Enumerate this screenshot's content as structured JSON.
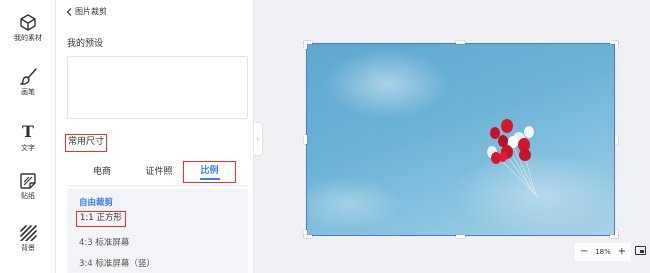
{
  "rail": [
    {
      "label": "我的素材",
      "icon": "cube-icon"
    },
    {
      "label": "画笔",
      "icon": "brush-icon"
    },
    {
      "label": "文字",
      "icon": "text-icon",
      "glyph": "T"
    },
    {
      "label": "贴纸",
      "icon": "sticker-icon"
    },
    {
      "label": "背景",
      "icon": "background-pattern-icon"
    }
  ],
  "panel": {
    "back_label": "图片裁剪",
    "preset_title": "我的预设",
    "common_title": "常用尺寸",
    "tabs": [
      "电商",
      "证件照",
      "比例"
    ],
    "active_tab": "比例",
    "ratios": [
      "自由裁剪",
      "1:1 正方形",
      "4:3 标准屏幕",
      "3:4 标准屏幕（竖）"
    ],
    "selected_ratio": "自由裁剪",
    "collapse_glyph": "‹"
  },
  "canvas": {
    "image": "red and white balloons in blue sky",
    "selection_color": "#4a7bd9"
  },
  "zoom": {
    "minus": "−",
    "value": "18%",
    "plus": "+"
  },
  "colors": {
    "accent": "#3a7cff",
    "highlight": "#e03131"
  }
}
